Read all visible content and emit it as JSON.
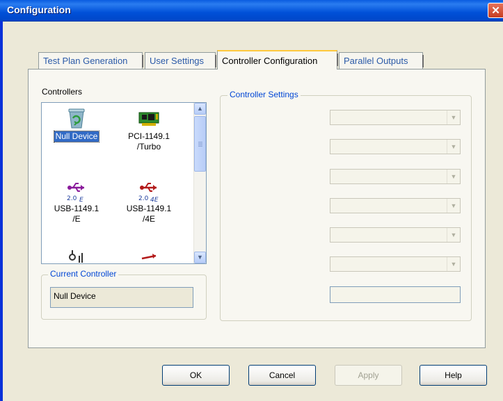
{
  "window": {
    "title": "Configuration",
    "close_glyph": "✕"
  },
  "tabs": [
    {
      "label": "Test Plan Generation",
      "active": false
    },
    {
      "label": "User Settings",
      "active": false
    },
    {
      "label": "Controller Configuration",
      "active": true
    },
    {
      "label": "Parallel Outputs",
      "active": false
    }
  ],
  "controllers": {
    "label": "Controllers",
    "items": [
      {
        "label": "Null Device",
        "icon": "recycle-bin-icon",
        "selected": true
      },
      {
        "label": "PCI-1149.1 /Turbo",
        "icon": "pci-card-icon",
        "selected": false
      },
      {
        "label": "USB-1149.1 /E",
        "icon": "usb-icon",
        "badge": "2.0 E",
        "selected": false
      },
      {
        "label": "USB-1149.1 /4E",
        "icon": "usb-icon",
        "badge": "2.0 4E",
        "selected": false
      }
    ]
  },
  "current_controller": {
    "legend": "Current Controller",
    "value": "Null Device"
  },
  "controller_settings": {
    "legend": "Controller Settings",
    "dropdown_count": 6
  },
  "buttons": {
    "ok": "OK",
    "cancel": "Cancel",
    "apply": "Apply",
    "help": "Help"
  },
  "colors": {
    "title_bar": "#0050d8",
    "selection": "#316ac5",
    "legend_text": "#0046d5",
    "active_tab_highlight": "#ffc83c"
  }
}
